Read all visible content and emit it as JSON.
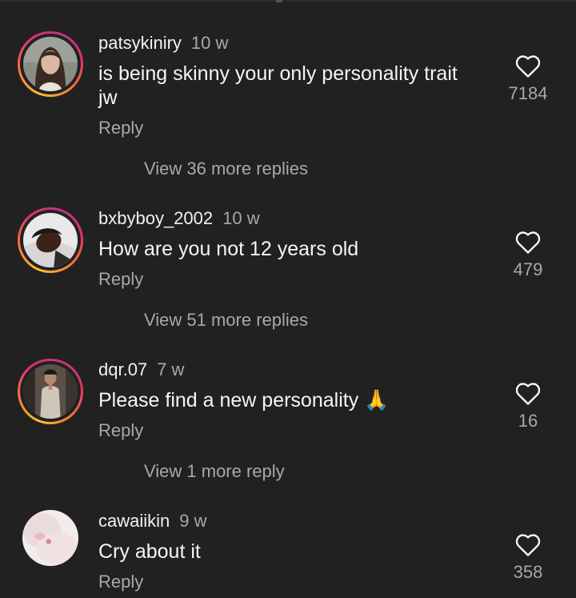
{
  "comments": [
    {
      "username": "patsykiniry",
      "time": "10 w",
      "text_lines": [
        "is being skinny your only personality trait",
        "jw"
      ],
      "reply": "Reply",
      "view_more": "View 36 more replies",
      "likes": "7184",
      "avatar": "woman-portrait-avatar",
      "story_ring": true
    },
    {
      "username": "bxbyboy_2002",
      "time": "10 w",
      "text_lines": [
        "How are you not 12 years old"
      ],
      "reply": "Reply",
      "view_more": "View 51 more replies",
      "likes": "479",
      "avatar": "man-lying-down-avatar",
      "story_ring": true
    },
    {
      "username": "dqr.07",
      "time": "7 w",
      "text": "Please find a new personality",
      "emoji": "🙏",
      "reply": "Reply",
      "view_more": "View 1 more reply",
      "likes": "16",
      "avatar": "mirror-selfie-avatar",
      "story_ring": true
    },
    {
      "username": "cawaiikin",
      "time": "9 w",
      "text_lines": [
        "Cry about it"
      ],
      "reply": "Reply",
      "likes": "358",
      "avatar": "pink-blur-avatar",
      "story_ring": false
    }
  ],
  "colors": {
    "background": "#212121",
    "primary_text": "#f5f5f5",
    "secondary_text": "#a8a8a8",
    "story_ring": [
      "#f9c12e",
      "#f77737",
      "#e1306c",
      "#c13584"
    ]
  },
  "icons": {
    "like": "heart-outline-icon"
  }
}
